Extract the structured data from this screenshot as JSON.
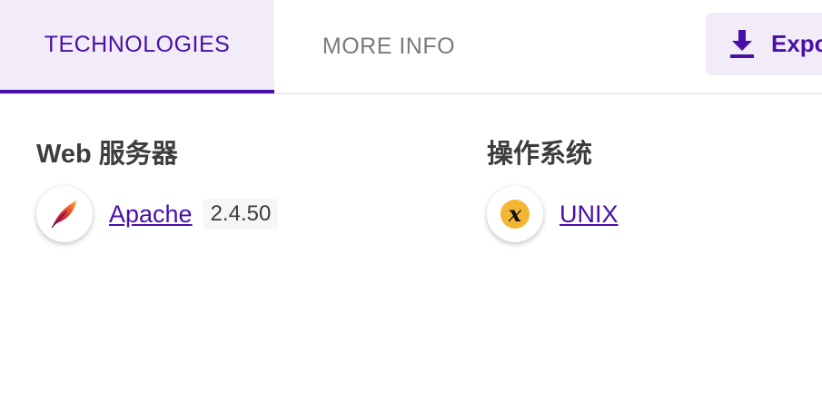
{
  "tabs": [
    {
      "label": "TECHNOLOGIES",
      "active": true
    },
    {
      "label": "MORE INFO",
      "active": false
    }
  ],
  "export_button": {
    "label": "Expo",
    "icon": "download-icon"
  },
  "sections": [
    {
      "title": "Web 服务器",
      "items": [
        {
          "name": "Apache",
          "version": "2.4.50",
          "icon": "apache-feather-icon"
        }
      ]
    },
    {
      "title": "操作系统",
      "items": [
        {
          "name": "UNIX",
          "icon": "unix-icon"
        }
      ]
    }
  ],
  "colors": {
    "accent": "#4a0fa8",
    "tab_active_bg": "#f1ecf8",
    "inactive_tab_text": "#7a7a7a",
    "heading_text": "#3d3d3d",
    "unix_icon": "#f2b632"
  }
}
